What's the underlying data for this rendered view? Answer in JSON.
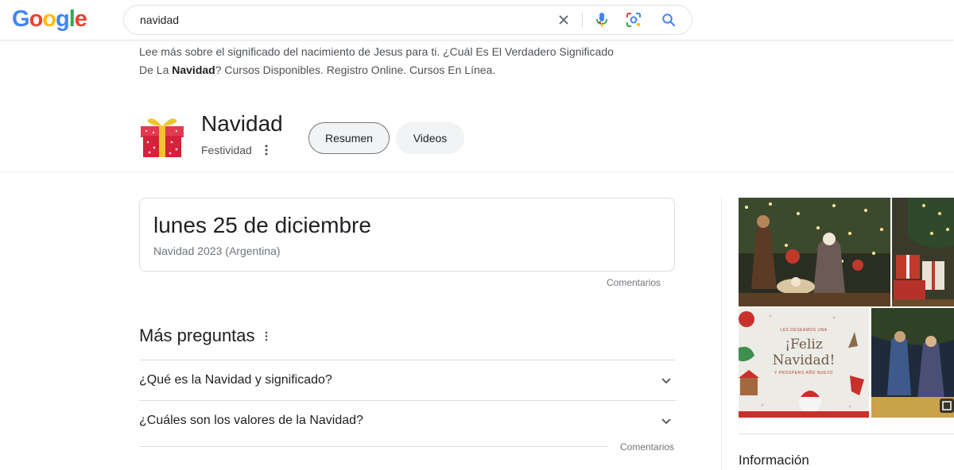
{
  "header": {
    "logo_text": "Google",
    "logo_letters": [
      {
        "ch": "G",
        "color": "#4285f4"
      },
      {
        "ch": "o",
        "color": "#ea4335"
      },
      {
        "ch": "o",
        "color": "#fbbc05"
      },
      {
        "ch": "g",
        "color": "#4285f4"
      },
      {
        "ch": "l",
        "color": "#34a853"
      },
      {
        "ch": "e",
        "color": "#ea4335"
      }
    ],
    "search_value": "navidad",
    "icons": [
      "clear-icon",
      "microphone-icon",
      "lens-icon",
      "search-icon"
    ]
  },
  "snippet": {
    "line1": "Lee más sobre el significado del nacimiento de Jesus para ti. ¿Cuál Es El Verdadero Significado",
    "line2_pre": "De La ",
    "line2_bold": "Navidad",
    "line2_post": "? Cursos Disponibles. Registro Online. Cursos En Línea."
  },
  "entity": {
    "title": "Navidad",
    "subtitle": "Festividad",
    "tabs": [
      "Resumen",
      "Videos"
    ]
  },
  "date_card": {
    "date": "lunes 25 de diciembre",
    "detail": "Navidad 2023 (Argentina)",
    "feedback": "Comentarios"
  },
  "more_questions": {
    "title": "Más preguntas",
    "questions": [
      "¿Qué es la Navidad y significado?",
      "¿Cuáles son los valores de la Navidad?"
    ],
    "feedback": "Comentarios"
  },
  "right_panel": {
    "card_greeting": "¡Feliz Navidad!",
    "card_top": "LES DESEAMOS UNA",
    "card_bottom": "Y PRÓSPERO AÑO NUEVO",
    "info_title": "Información"
  },
  "colors": {
    "accent_blue": "#4285f4",
    "text_primary": "#202124",
    "text_secondary": "#70757a",
    "gift_red": "#d6213a",
    "gift_ribbon": "#f4c430"
  }
}
